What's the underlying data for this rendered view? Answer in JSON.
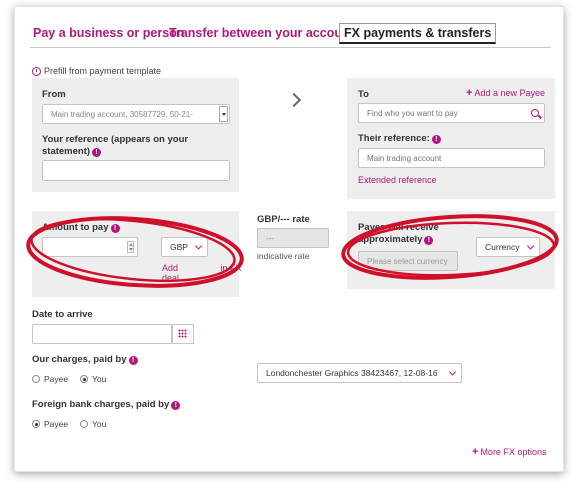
{
  "tabs": [
    {
      "label": "Pay a business or person"
    },
    {
      "label": "Transfer between your accounts"
    },
    {
      "label": "FX payments & transfers"
    }
  ],
  "prefill_label": "Prefill from payment template",
  "from": {
    "label": "From",
    "account_value": "Main trading account, 30587729, 50-21-",
    "reference_label": "Your reference (appears on your statement)",
    "reference_value": ""
  },
  "to": {
    "label": "To",
    "add_payee": "Add a new Payee",
    "search_placeholder": "Find who you want to pay",
    "their_reference_label": "Their reference:",
    "their_reference_value": "Main trading account",
    "extended_reference": "Extended reference"
  },
  "amount": {
    "label": "Amount to pay",
    "value": "",
    "currency": "GBP",
    "deal_link": "Add",
    "deal_link_tail": "deal",
    "deal_link_mid": "in FX"
  },
  "rate": {
    "label": "GBP/--- rate",
    "value": "---",
    "note": "indicative rate"
  },
  "payee_receive": {
    "label": "Payee will receive approximately",
    "placeholder": "Please select currency",
    "currency": "Currency"
  },
  "date": {
    "label": "Date to arrive",
    "value": ""
  },
  "our_charges": {
    "label": "Our charges, paid by",
    "options": [
      "Payee",
      "You"
    ],
    "selected": "You"
  },
  "charges_account": {
    "value": "Londonchester Graphics 38423467, 12-08-16"
  },
  "foreign_charges": {
    "label": "Foreign bank charges, paid by",
    "options": [
      "Payee",
      "You"
    ],
    "selected": "Payee"
  },
  "more_options": "More FX options",
  "colors": {
    "accent": "#b0177e",
    "annotation": "#d0102a",
    "panel": "#eeeeee"
  }
}
